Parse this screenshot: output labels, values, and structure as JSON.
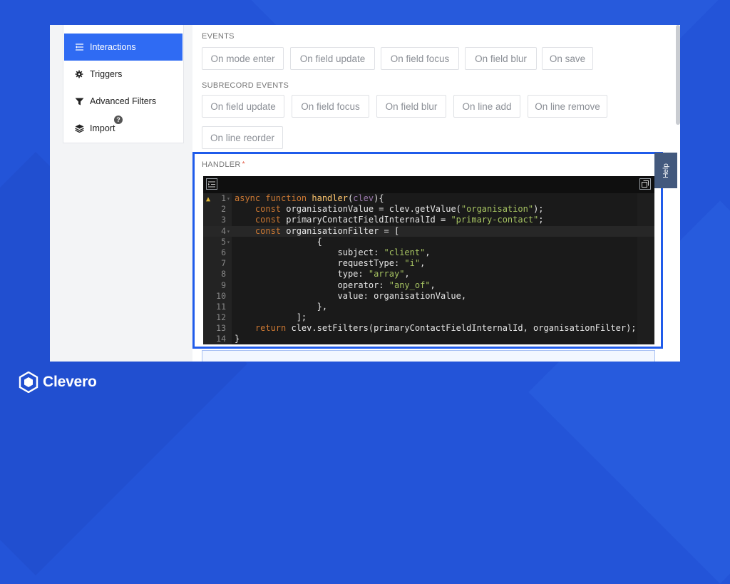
{
  "sidebar": {
    "items": [
      {
        "label": "Interactions",
        "icon": "interactions-icon",
        "active": true
      },
      {
        "label": "Triggers",
        "icon": "gear-icon",
        "active": false
      },
      {
        "label": "Advanced Filters",
        "icon": "filter-icon",
        "active": false
      },
      {
        "label": "Import",
        "icon": "layers-icon",
        "active": false
      }
    ],
    "help_badge": "?"
  },
  "events": {
    "label": "EVENTS",
    "chips": [
      "On mode enter",
      "On field update",
      "On field focus",
      "On field blur",
      "On save"
    ]
  },
  "subrecord_events": {
    "label": "SUBRECORD EVENTS",
    "chips": [
      "On field update",
      "On field focus",
      "On field blur",
      "On line add",
      "On line remove",
      "On line reorder"
    ]
  },
  "handler": {
    "label": "HANDLER",
    "required_mark": "*",
    "line_numbers": [
      "1",
      "2",
      "3",
      "4",
      "5",
      "6",
      "7",
      "8",
      "9",
      "10",
      "11",
      "12",
      "13",
      "14"
    ],
    "active_line": 4,
    "warning_line": 1
  },
  "help_tab": {
    "label": "Help"
  },
  "brand": {
    "name": "Clevero",
    "accent": "#2f6bf3",
    "background": "#2354d8"
  }
}
